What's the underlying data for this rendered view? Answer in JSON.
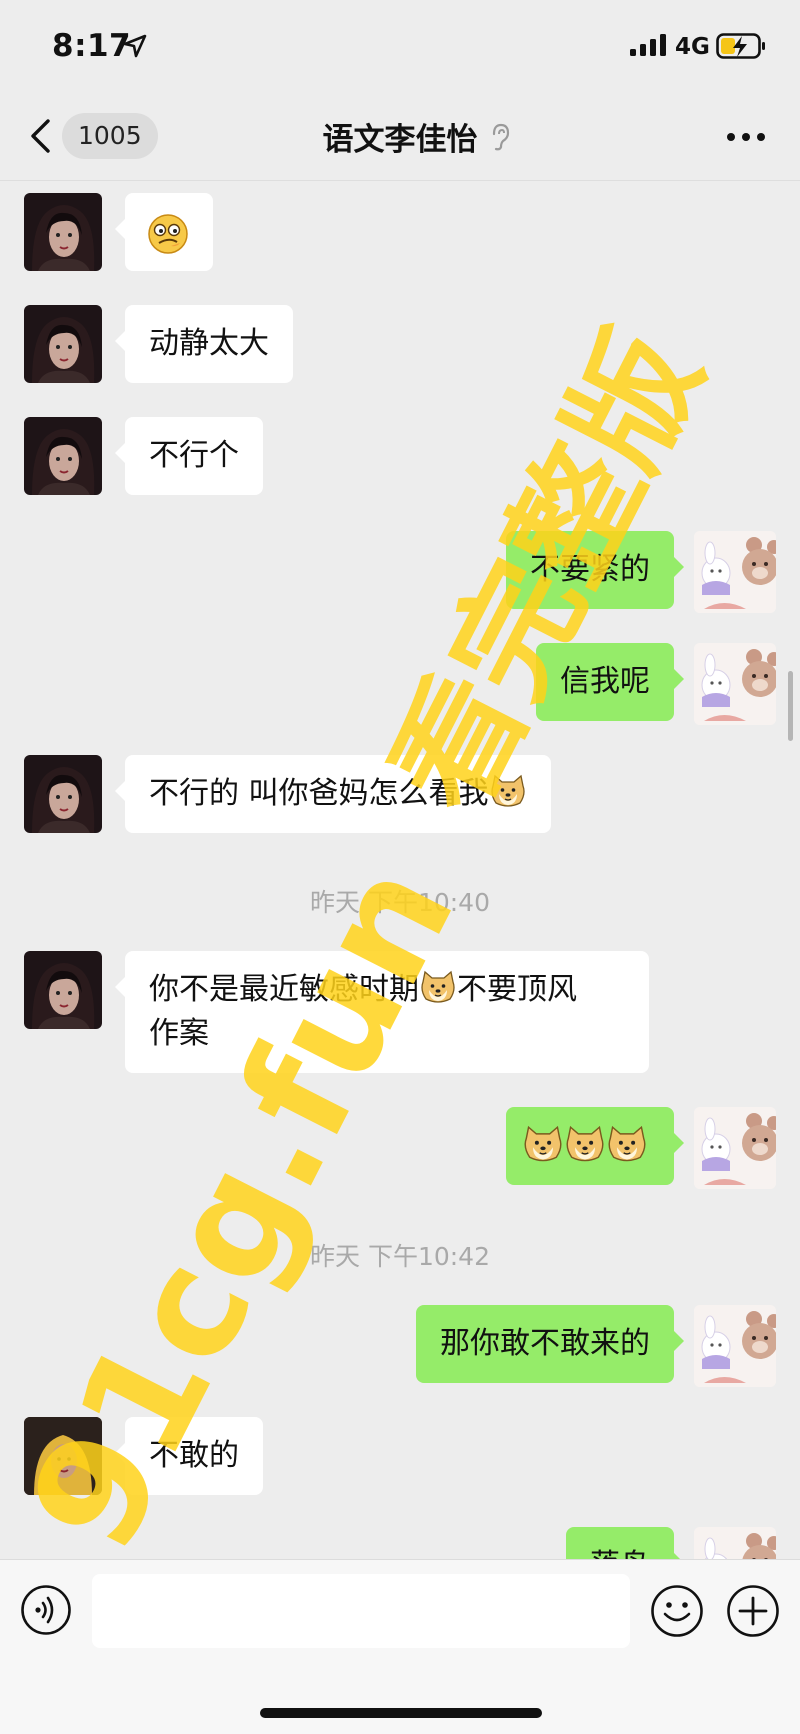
{
  "status_bar": {
    "time": "8:17",
    "network": "4G",
    "icons": [
      "location-arrow-icon",
      "signal-icon",
      "battery-charging-icon"
    ]
  },
  "nav": {
    "unread_count": "1005",
    "title": "语文李佳怡",
    "icons": [
      "chevron-left-icon",
      "ear-icon",
      "more-icon"
    ]
  },
  "messages": [
    {
      "side": "in",
      "text": "",
      "emoji": "smirk-emoji"
    },
    {
      "side": "in",
      "text": "动静太大"
    },
    {
      "side": "in",
      "text": "不行个"
    },
    {
      "side": "out",
      "text": "不要紧的"
    },
    {
      "side": "out",
      "text": "信我呢"
    },
    {
      "side": "in",
      "text": "不行的 叫你爸妈怎么看我",
      "emoji": "doge-emoji"
    },
    {
      "side": "timestamp",
      "text": "昨天 下午10:40"
    },
    {
      "side": "in",
      "text_a": "你不是最近敏感时期",
      "text_b": "不要顶风",
      "text_c": "作案",
      "emoji": "doge-emoji"
    },
    {
      "side": "out",
      "text": "",
      "emoji": "doge-emoji",
      "emoji_count": 3
    },
    {
      "side": "timestamp",
      "text": "昨天 下午10:42"
    },
    {
      "side": "out",
      "text": "那你敢不敢来的"
    },
    {
      "side": "in",
      "text": "不敢的"
    },
    {
      "side": "out",
      "text": "落鸟"
    }
  ],
  "watermark": {
    "line1": "91cg.fun",
    "line2": "看完整版",
    "color": "#ffd21a"
  },
  "input_bar": {
    "placeholder": "",
    "icons": [
      "voice-icon",
      "emoji-icon",
      "plus-icon"
    ]
  },
  "colors": {
    "background": "#ededed",
    "outgoing_bubble": "#95ec69",
    "incoming_bubble": "#ffffff"
  }
}
